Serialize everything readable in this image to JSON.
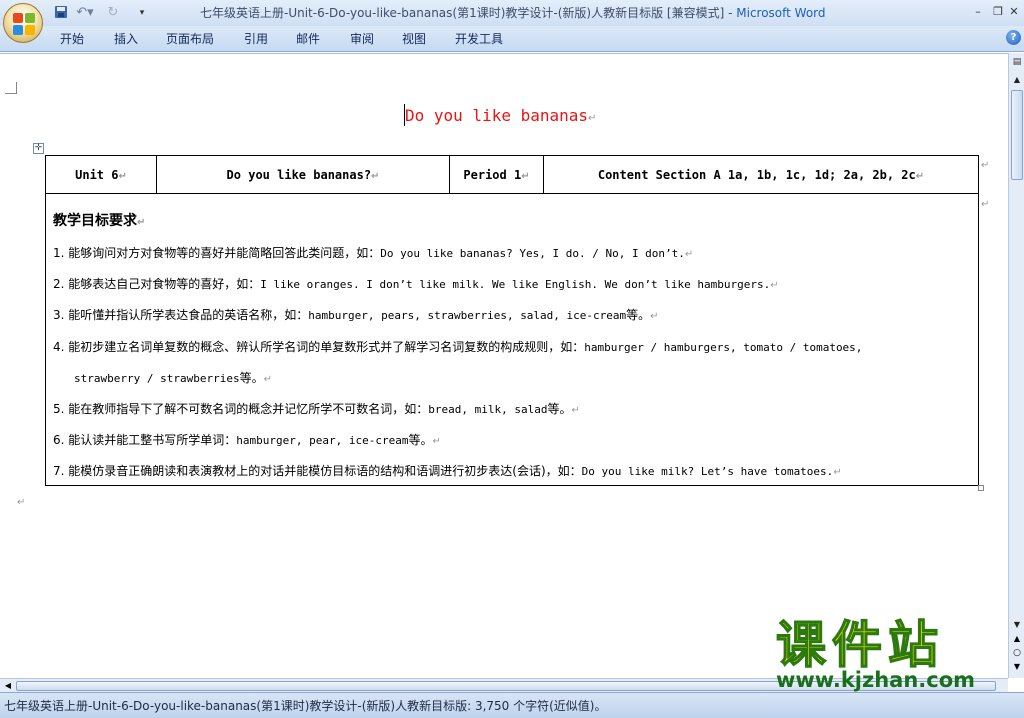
{
  "window": {
    "title": "七年级英语上册-Unit-6-Do-you-like-bananas(第1课时)教学设计-(新版)人教新目标版 [兼容模式]",
    "separator": " - ",
    "app_name": "Microsoft Word"
  },
  "ribbon": {
    "tabs": [
      "开始",
      "插入",
      "页面布局",
      "引用",
      "邮件",
      "审阅",
      "视图",
      "开发工具"
    ]
  },
  "document": {
    "heading": "Do you like bananas",
    "paragraph_mark": "↵",
    "table": {
      "header": {
        "unit": "Unit 6",
        "title": "Do you like bananas?",
        "period": "Period 1",
        "content": "Content  Section A  1a, 1b, 1c, 1d; 2a, 2b, 2c"
      },
      "objectives_title": "教学目标要求",
      "objectives": [
        {
          "cn": "1. 能够询问对方对食物等的喜好并能简略回答此类问题，如：",
          "en": "Do you like bananas? Yes, I do. / No, I don’t."
        },
        {
          "cn": "2. 能够表达自己对食物等的喜好，如：",
          "en": "I like oranges. I don’t like milk. We like English. We don’t like hamburgers."
        },
        {
          "cn": "3. 能听懂并指认所学表达食品的英语名称，如：",
          "en": "hamburger, pears, strawberries, salad, ice-cream",
          "cn_after": "等。"
        },
        {
          "cn": "4. 能初步建立名词单复数的概念、辨认所学名词的单复数形式并了解学习名词复数的构成规则，如：",
          "en": "hamburger / hamburgers, tomato / tomatoes,"
        },
        {
          "cn": "",
          "en": "strawberry / strawberries",
          "cn_after": "等。",
          "indent": true
        },
        {
          "cn": "5. 能在教师指导下了解不可数名词的概念并记忆所学不可数名词，如：",
          "en": "bread, milk, salad",
          "cn_after": "等。"
        },
        {
          "cn": "6. 能认读并能工整书写所学单词：",
          "en": "hamburger, pear, ice-cream",
          "cn_after": "等。"
        },
        {
          "cn": "7. 能模仿录音正确朗读和表演教材上的对话并能模仿目标语的结构和语调进行初步表达(会话)，如：",
          "en": "Do you like milk? Let’s have tomatoes."
        }
      ]
    }
  },
  "status_bar": {
    "text": "七年级英语上册-Unit-6-Do-you-like-bananas(第1课时)教学设计-(新版)人教新目标版: 3,750 个字符(近似值)。"
  },
  "watermark": {
    "chinese": "课件站",
    "url": "www.kjzhan.com"
  },
  "icons": {
    "office_button": "office-logo-icon",
    "save": "save-icon",
    "undo": "undo-icon",
    "redo": "redo-icon",
    "help": "help-icon",
    "logo_colors": [
      "#e8491d",
      "#7cb82f",
      "#2a8de0",
      "#f7b500"
    ]
  }
}
